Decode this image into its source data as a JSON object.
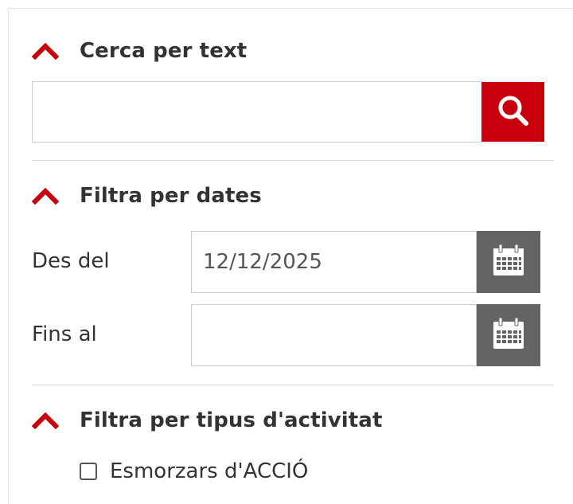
{
  "colors": {
    "accent_red": "#c8000b",
    "calendar_button_gray": "#646464",
    "text": "#333333",
    "divider": "#dddddd"
  },
  "text_search": {
    "title": "Cerca per text",
    "value": "",
    "button_icon": "search-icon"
  },
  "date_filter": {
    "title": "Filtra per dates",
    "from_label": "Des del",
    "from_value": "12/12/2025",
    "to_label": "Fins al",
    "to_value": "",
    "button_icon": "calendar-icon"
  },
  "activity_filter": {
    "title": "Filtra per tipus d'activitat",
    "options": [
      {
        "label": "Esmorzars d'ACCIÓ",
        "checked": false
      }
    ]
  }
}
